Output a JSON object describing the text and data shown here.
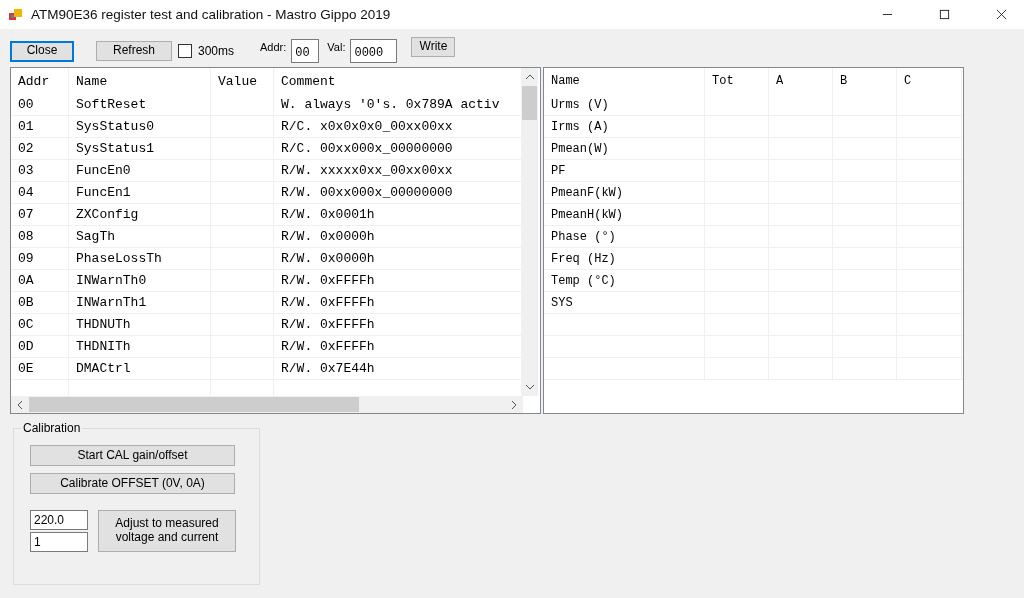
{
  "window": {
    "title": "ATM90E36 register test and calibration - Mastro Gippo 2019"
  },
  "toolbar": {
    "close_button": "Close",
    "refresh_button": "Refresh",
    "fast_refresh": {
      "label": "300ms",
      "checked": false
    },
    "addr_label": "Addr:",
    "addr_value": "00",
    "val_label": "Val:",
    "val_value": "0000",
    "write_button": "Write"
  },
  "registers": {
    "columns": [
      "Addr",
      "Name",
      "Value",
      "Comment"
    ],
    "rows": [
      [
        "00",
        "SoftReset",
        "",
        "W. always '0's. 0x789A activ"
      ],
      [
        "01",
        "SysStatus0",
        "",
        "R/C. x0x0x0x0_00xx00xx"
      ],
      [
        "02",
        "SysStatus1",
        "",
        "R/C. 00xx000x_00000000"
      ],
      [
        "03",
        "FuncEn0",
        "",
        "R/W. xxxxx0xx_00xx00xx"
      ],
      [
        "04",
        "FuncEn1",
        "",
        "R/W. 00xx000x_00000000"
      ],
      [
        "07",
        "ZXConfig",
        "",
        "R/W. 0x0001h"
      ],
      [
        "08",
        "SagTh",
        "",
        "R/W. 0x0000h"
      ],
      [
        "09",
        "PhaseLossTh",
        "",
        "R/W. 0x0000h"
      ],
      [
        "0A",
        "INWarnTh0",
        "",
        "R/W. 0xFFFFh"
      ],
      [
        "0B",
        "INWarnTh1",
        "",
        "R/W. 0xFFFFh"
      ],
      [
        "0C",
        "THDNUTh",
        "",
        "R/W. 0xFFFFh"
      ],
      [
        "0D",
        "THDNITh",
        "",
        "R/W. 0xFFFFh"
      ],
      [
        "0E",
        "DMACtrl",
        "",
        "R/W. 0x7E44h"
      ]
    ]
  },
  "measurements": {
    "columns": [
      "Name",
      "Tot",
      "A",
      "B",
      "C"
    ],
    "rows": [
      "Urms (V)",
      "Irms (A)",
      "Pmean(W)",
      "PF",
      "PmeanF(kW)",
      "PmeanH(kW)",
      "Phase (°)",
      "Freq (Hz)",
      "Temp (°C)",
      "SYS"
    ]
  },
  "calibration": {
    "title": "Calibration",
    "start_button": "Start CAL gain/offset",
    "offset_button": "Calibrate OFFSET (0V, 0A)",
    "voltage_value": "220.0",
    "current_value": "1",
    "adjust_button": "Adjust to measured voltage and current"
  }
}
